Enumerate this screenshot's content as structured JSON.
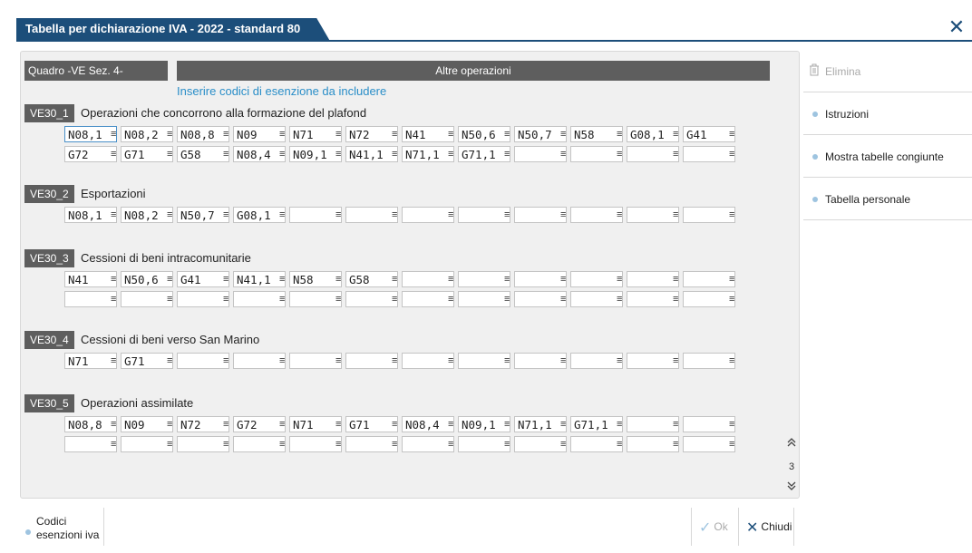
{
  "window": {
    "title": "Tabella per dichiarazione IVA - 2022 - standard 80",
    "close_glyph": "✕"
  },
  "header": {
    "left": "Quadro -VE Sez. 4-",
    "right": "Altre operazioni",
    "subtitle": "Inserire codici di esenzione da includere"
  },
  "sections": [
    {
      "code": "VE30_1",
      "desc": "Operazioni che concorrono alla formazione del plafond",
      "rows": [
        [
          "N08,1",
          "N08,2",
          "N08,8",
          "N09",
          "N71",
          "N72",
          "N41",
          "N50,6",
          "N50,7",
          "N58",
          "G08,1",
          "G41"
        ],
        [
          "G72",
          "G71",
          "G58",
          "N08,4",
          "N09,1",
          "N41,1",
          "N71,1",
          "G71,1",
          "",
          "",
          "",
          ""
        ]
      ]
    },
    {
      "code": "VE30_2",
      "desc": "Esportazioni",
      "rows": [
        [
          "N08,1",
          "N08,2",
          "N50,7",
          "G08,1",
          "",
          "",
          "",
          "",
          "",
          "",
          "",
          ""
        ]
      ]
    },
    {
      "code": "VE30_3",
      "desc": "Cessioni di beni intracomunitarie",
      "rows": [
        [
          "N41",
          "N50,6",
          "G41",
          "N41,1",
          "N58",
          "G58",
          "",
          "",
          "",
          "",
          "",
          ""
        ],
        [
          "",
          "",
          "",
          "",
          "",
          "",
          "",
          "",
          "",
          "",
          "",
          ""
        ]
      ]
    },
    {
      "code": "VE30_4",
      "desc": "Cessioni di beni verso San Marino",
      "rows": [
        [
          "N71",
          "G71",
          "",
          "",
          "",
          "",
          "",
          "",
          "",
          "",
          "",
          ""
        ]
      ]
    },
    {
      "code": "VE30_5",
      "desc": "Operazioni assimilate",
      "rows": [
        [
          "N08,8",
          "N09",
          "N72",
          "G72",
          "N71",
          "G71",
          "N08,4",
          "N09,1",
          "N71,1",
          "G71,1",
          "",
          ""
        ],
        [
          "",
          "",
          "",
          "",
          "",
          "",
          "",
          "",
          "",
          "",
          "",
          ""
        ]
      ]
    }
  ],
  "cell_button_glyph": "≡",
  "pager": {
    "page": "3",
    "up_glyph": "⌃",
    "down_glyph": "⌄"
  },
  "sidebar": {
    "items": [
      {
        "label": "Elimina",
        "icon": "trash-icon",
        "disabled": true
      },
      {
        "label": "Istruzioni"
      },
      {
        "label": "Mostra tabelle congiunte"
      },
      {
        "label": "Tabella personale"
      }
    ]
  },
  "footer": {
    "codici_line1": "Codici",
    "codici_line2": "esenzioni iva",
    "ok_label": "Ok",
    "ok_glyph": "✓",
    "close_label": "Chiudi",
    "close_glyph": "✕"
  },
  "colors": {
    "title_bg": "#1c4e7a",
    "header_bg": "#5e5e5e",
    "subtitle": "#2a8ec8",
    "accent_dot": "#9ec4e0"
  }
}
